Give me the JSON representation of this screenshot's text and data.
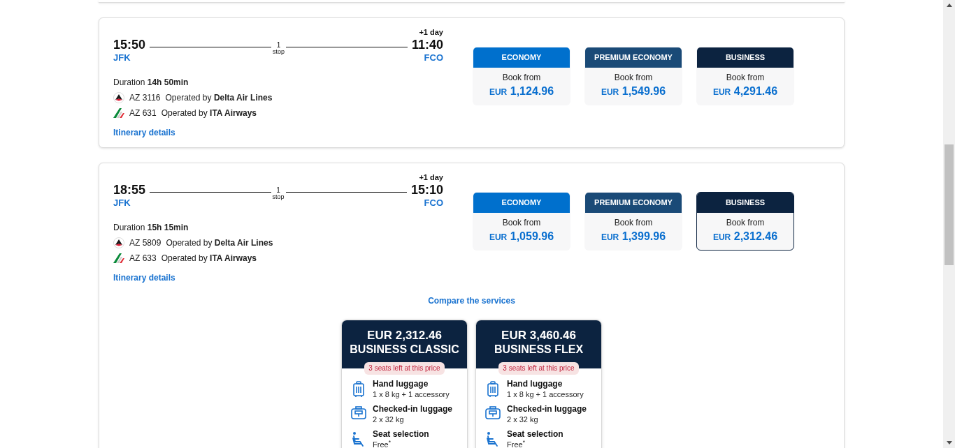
{
  "flights": [
    {
      "departure_time": "15:50",
      "departure_airport": "JFK",
      "arrival_time": "11:40",
      "arrival_airport": "FCO",
      "day_offset": "+1 day",
      "stops_count": "1",
      "stops_label": "stop",
      "duration_label": "Duration",
      "duration": "14h 50min",
      "segments": [
        {
          "kind": "delta",
          "flight": "AZ 3116",
          "operated_label": "Operated by",
          "carrier": "Delta Air Lines"
        },
        {
          "kind": "ita",
          "flight": "AZ 631",
          "operated_label": "Operated by",
          "carrier": "ITA Airways"
        }
      ],
      "details_link": "Itinerary details",
      "fares": [
        {
          "kind": "economy",
          "cabin": "ECONOMY",
          "label": "Book from",
          "currency": "EUR",
          "price": "1,124.96",
          "selected": false
        },
        {
          "kind": "premium",
          "cabin": "PREMIUM ECONOMY",
          "label": "Book from",
          "currency": "EUR",
          "price": "1,549.96",
          "selected": false
        },
        {
          "kind": "business",
          "cabin": "BUSINESS",
          "label": "Book from",
          "currency": "EUR",
          "price": "4,291.46",
          "selected": false
        }
      ]
    },
    {
      "departure_time": "18:55",
      "departure_airport": "JFK",
      "arrival_time": "15:10",
      "arrival_airport": "FCO",
      "day_offset": "+1 day",
      "stops_count": "1",
      "stops_label": "stop",
      "duration_label": "Duration",
      "duration": "15h 15min",
      "segments": [
        {
          "kind": "delta",
          "flight": "AZ 5809",
          "operated_label": "Operated by",
          "carrier": "Delta Air Lines"
        },
        {
          "kind": "ita",
          "flight": "AZ 633",
          "operated_label": "Operated by",
          "carrier": "ITA Airways"
        }
      ],
      "details_link": "Itinerary details",
      "fares": [
        {
          "kind": "economy",
          "cabin": "ECONOMY",
          "label": "Book from",
          "currency": "EUR",
          "price": "1,059.96",
          "selected": false
        },
        {
          "kind": "premium",
          "cabin": "PREMIUM ECONOMY",
          "label": "Book from",
          "currency": "EUR",
          "price": "1,399.96",
          "selected": false
        },
        {
          "kind": "business",
          "cabin": "BUSINESS",
          "label": "Book from",
          "currency": "EUR",
          "price": "2,312.46",
          "selected": true
        }
      ],
      "compare": {
        "link": "Compare the services",
        "options": [
          {
            "price": "EUR 2,312.46",
            "name": "BUSINESS CLASSIC",
            "badge": "3 seats left at this price",
            "services": [
              {
                "kind": "hand",
                "title": "Hand luggage",
                "detail": "1 x 8 kg + 1 accessory"
              },
              {
                "kind": "checked",
                "title": "Checked-in luggage",
                "detail": "2 x 32 kg"
              },
              {
                "kind": "seat",
                "title": "Seat selection",
                "detail": "Free$^{*}$"
              }
            ]
          },
          {
            "price": "EUR 3,460.46",
            "name": "BUSINESS FLEX",
            "badge": "3 seats left at this price",
            "services": [
              {
                "kind": "hand",
                "title": "Hand luggage",
                "detail": "1 x 8 kg + 1 accessory"
              },
              {
                "kind": "checked",
                "title": "Checked-in luggage",
                "detail": "2 x 32 kg"
              },
              {
                "kind": "seat",
                "title": "Seat selection",
                "detail": "Free$^{*}$"
              }
            ]
          }
        ]
      }
    }
  ]
}
